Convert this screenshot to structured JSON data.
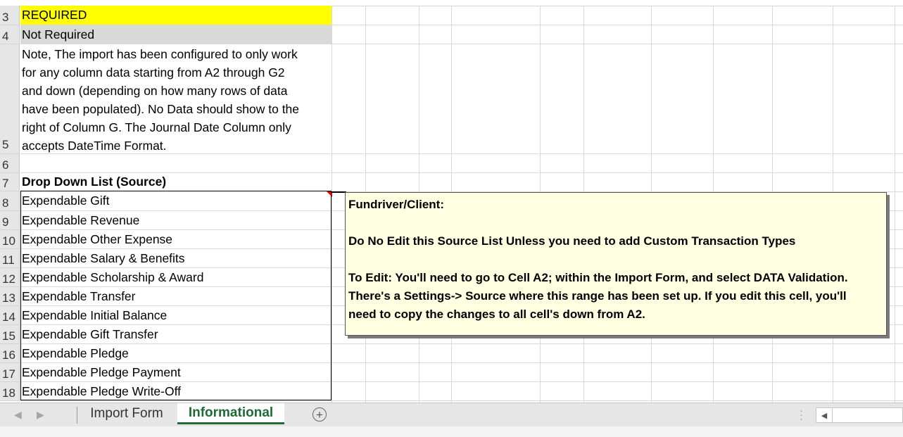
{
  "rows": [
    {
      "num": "3",
      "text": "REQUIRED"
    },
    {
      "num": "4",
      "text": "Not Required"
    },
    {
      "num": "5",
      "text": ""
    },
    {
      "num": "6",
      "text": ""
    },
    {
      "num": "7",
      "text": "Drop Down List (Source)"
    },
    {
      "num": "8",
      "text": "Expendable Gift"
    },
    {
      "num": "9",
      "text": "Expendable Revenue"
    },
    {
      "num": "10",
      "text": "Expendable Other Expense"
    },
    {
      "num": "11",
      "text": "Expendable Salary & Benefits"
    },
    {
      "num": "12",
      "text": "Expendable Scholarship & Award"
    },
    {
      "num": "13",
      "text": "Expendable Transfer"
    },
    {
      "num": "14",
      "text": "Expendable Initial Balance"
    },
    {
      "num": "15",
      "text": "Expendable Gift Transfer"
    },
    {
      "num": "16",
      "text": "Expendable Pledge"
    },
    {
      "num": "17",
      "text": "Expendable Pledge Payment"
    },
    {
      "num": "18",
      "text": "Expendable Pledge Write-Off"
    }
  ],
  "note_lines": [
    "Note, The import has been configured to only work",
    "for any column data starting from A2 through G2",
    "and down (depending on how many rows of data",
    "have been populated). No Data should show to the",
    "right of Column G.  The Journal Date Column only",
    "accepts DateTime Format."
  ],
  "comment": {
    "line1": "Fundriver/Client:",
    "line2": "Do No Edit this Source List Unless you need to add Custom Transaction Types",
    "line3": "To Edit: You'll need to go to Cell A2; within the Import Form, and select DATA Validation.",
    "line4": "There's a Settings-> Source where this range has been set up. If you edit this cell, you'll",
    "line5": "need to copy the changes to all cell's down from A2."
  },
  "tabs": {
    "tab1": "Import Form",
    "tab2": "Informational",
    "add_icon": "plus-circle-icon"
  },
  "colors": {
    "required_fill": "#ffff00",
    "not_required_fill": "#d9d9d9",
    "active_tab": "#1e6b35",
    "comment_bg": "#ffffe1"
  }
}
